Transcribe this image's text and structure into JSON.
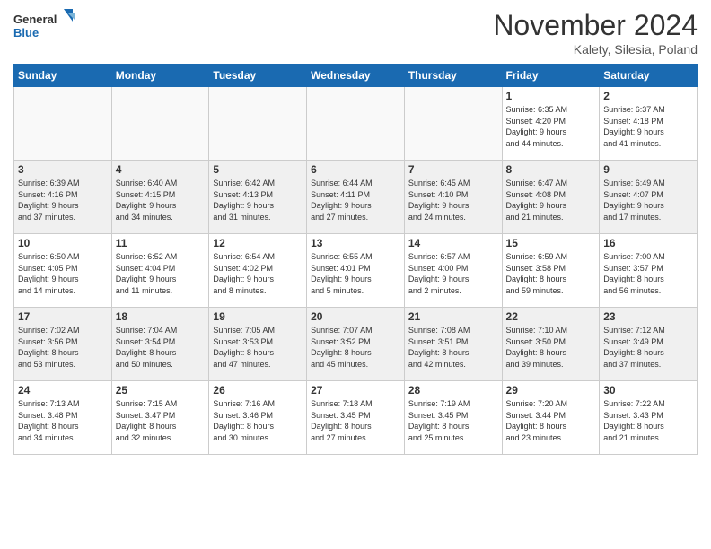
{
  "header": {
    "logo_line1": "General",
    "logo_line2": "Blue",
    "month": "November 2024",
    "location": "Kalety, Silesia, Poland"
  },
  "days_of_week": [
    "Sunday",
    "Monday",
    "Tuesday",
    "Wednesday",
    "Thursday",
    "Friday",
    "Saturday"
  ],
  "weeks": [
    [
      {
        "day": "",
        "info": ""
      },
      {
        "day": "",
        "info": ""
      },
      {
        "day": "",
        "info": ""
      },
      {
        "day": "",
        "info": ""
      },
      {
        "day": "",
        "info": ""
      },
      {
        "day": "1",
        "info": "Sunrise: 6:35 AM\nSunset: 4:20 PM\nDaylight: 9 hours\nand 44 minutes."
      },
      {
        "day": "2",
        "info": "Sunrise: 6:37 AM\nSunset: 4:18 PM\nDaylight: 9 hours\nand 41 minutes."
      }
    ],
    [
      {
        "day": "3",
        "info": "Sunrise: 6:39 AM\nSunset: 4:16 PM\nDaylight: 9 hours\nand 37 minutes."
      },
      {
        "day": "4",
        "info": "Sunrise: 6:40 AM\nSunset: 4:15 PM\nDaylight: 9 hours\nand 34 minutes."
      },
      {
        "day": "5",
        "info": "Sunrise: 6:42 AM\nSunset: 4:13 PM\nDaylight: 9 hours\nand 31 minutes."
      },
      {
        "day": "6",
        "info": "Sunrise: 6:44 AM\nSunset: 4:11 PM\nDaylight: 9 hours\nand 27 minutes."
      },
      {
        "day": "7",
        "info": "Sunrise: 6:45 AM\nSunset: 4:10 PM\nDaylight: 9 hours\nand 24 minutes."
      },
      {
        "day": "8",
        "info": "Sunrise: 6:47 AM\nSunset: 4:08 PM\nDaylight: 9 hours\nand 21 minutes."
      },
      {
        "day": "9",
        "info": "Sunrise: 6:49 AM\nSunset: 4:07 PM\nDaylight: 9 hours\nand 17 minutes."
      }
    ],
    [
      {
        "day": "10",
        "info": "Sunrise: 6:50 AM\nSunset: 4:05 PM\nDaylight: 9 hours\nand 14 minutes."
      },
      {
        "day": "11",
        "info": "Sunrise: 6:52 AM\nSunset: 4:04 PM\nDaylight: 9 hours\nand 11 minutes."
      },
      {
        "day": "12",
        "info": "Sunrise: 6:54 AM\nSunset: 4:02 PM\nDaylight: 9 hours\nand 8 minutes."
      },
      {
        "day": "13",
        "info": "Sunrise: 6:55 AM\nSunset: 4:01 PM\nDaylight: 9 hours\nand 5 minutes."
      },
      {
        "day": "14",
        "info": "Sunrise: 6:57 AM\nSunset: 4:00 PM\nDaylight: 9 hours\nand 2 minutes."
      },
      {
        "day": "15",
        "info": "Sunrise: 6:59 AM\nSunset: 3:58 PM\nDaylight: 8 hours\nand 59 minutes."
      },
      {
        "day": "16",
        "info": "Sunrise: 7:00 AM\nSunset: 3:57 PM\nDaylight: 8 hours\nand 56 minutes."
      }
    ],
    [
      {
        "day": "17",
        "info": "Sunrise: 7:02 AM\nSunset: 3:56 PM\nDaylight: 8 hours\nand 53 minutes."
      },
      {
        "day": "18",
        "info": "Sunrise: 7:04 AM\nSunset: 3:54 PM\nDaylight: 8 hours\nand 50 minutes."
      },
      {
        "day": "19",
        "info": "Sunrise: 7:05 AM\nSunset: 3:53 PM\nDaylight: 8 hours\nand 47 minutes."
      },
      {
        "day": "20",
        "info": "Sunrise: 7:07 AM\nSunset: 3:52 PM\nDaylight: 8 hours\nand 45 minutes."
      },
      {
        "day": "21",
        "info": "Sunrise: 7:08 AM\nSunset: 3:51 PM\nDaylight: 8 hours\nand 42 minutes."
      },
      {
        "day": "22",
        "info": "Sunrise: 7:10 AM\nSunset: 3:50 PM\nDaylight: 8 hours\nand 39 minutes."
      },
      {
        "day": "23",
        "info": "Sunrise: 7:12 AM\nSunset: 3:49 PM\nDaylight: 8 hours\nand 37 minutes."
      }
    ],
    [
      {
        "day": "24",
        "info": "Sunrise: 7:13 AM\nSunset: 3:48 PM\nDaylight: 8 hours\nand 34 minutes."
      },
      {
        "day": "25",
        "info": "Sunrise: 7:15 AM\nSunset: 3:47 PM\nDaylight: 8 hours\nand 32 minutes."
      },
      {
        "day": "26",
        "info": "Sunrise: 7:16 AM\nSunset: 3:46 PM\nDaylight: 8 hours\nand 30 minutes."
      },
      {
        "day": "27",
        "info": "Sunrise: 7:18 AM\nSunset: 3:45 PM\nDaylight: 8 hours\nand 27 minutes."
      },
      {
        "day": "28",
        "info": "Sunrise: 7:19 AM\nSunset: 3:45 PM\nDaylight: 8 hours\nand 25 minutes."
      },
      {
        "day": "29",
        "info": "Sunrise: 7:20 AM\nSunset: 3:44 PM\nDaylight: 8 hours\nand 23 minutes."
      },
      {
        "day": "30",
        "info": "Sunrise: 7:22 AM\nSunset: 3:43 PM\nDaylight: 8 hours\nand 21 minutes."
      }
    ]
  ]
}
